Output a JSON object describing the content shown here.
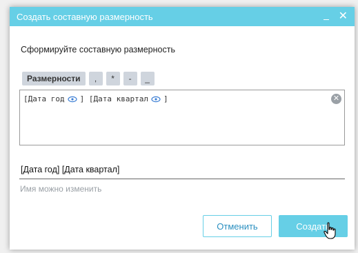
{
  "window": {
    "title": "Создать составную размерность",
    "minimize_icon": "minimize-icon",
    "close_icon": "close-icon"
  },
  "instruction": "Сформируйте составную размерность",
  "toolbar": {
    "items": [
      "Размерности",
      ",",
      "*",
      "-",
      "_"
    ]
  },
  "formula": {
    "parts": [
      "[Дата год",
      "] [Дата квартал",
      "]"
    ],
    "eye_icon": "eye-icon",
    "clear_icon": "clear-icon"
  },
  "name": {
    "value": "[Дата год] [Дата квартал]",
    "hint": "Имя можно изменить"
  },
  "buttons": {
    "cancel": "Отменить",
    "create": "Создать"
  },
  "colors": {
    "accent": "#66cfe6",
    "link_text": "#2a8fc0",
    "token_bg": "#cfd5dd"
  }
}
